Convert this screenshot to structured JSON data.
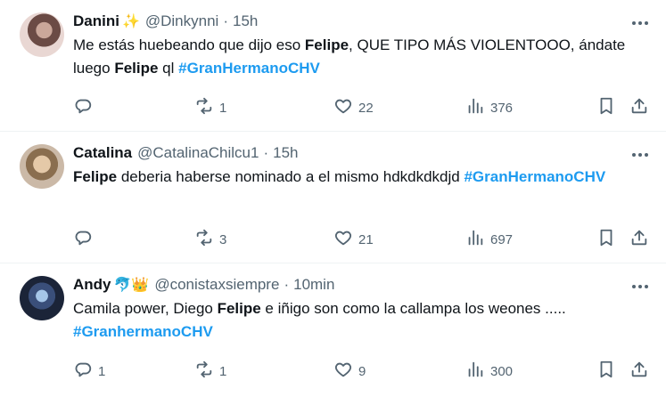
{
  "tweets": [
    {
      "name": "Danini",
      "emoji": "✨",
      "handle": "@Dinkynni",
      "dot": "·",
      "time": "15h",
      "text": [
        {
          "t": "Me estás huebeando que dijo eso ",
          "s": "n"
        },
        {
          "t": "Felipe",
          "s": "b"
        },
        {
          "t": ", QUE TIPO MÁS VIOLENTOOO, ándate luego ",
          "s": "n"
        },
        {
          "t": "Felipe",
          "s": "b"
        },
        {
          "t": " ql ",
          "s": "n"
        },
        {
          "t": "#GranHermanoCHV",
          "s": "h"
        }
      ],
      "replies": "",
      "retweets": "1",
      "likes": "22",
      "views": "376"
    },
    {
      "name": "Catalina",
      "emoji": "",
      "handle": "@CatalinaChilcu1",
      "dot": "·",
      "time": "15h",
      "text": [
        {
          "t": "Felipe",
          "s": "b"
        },
        {
          "t": " deberia haberse nominado a el mismo hdkdkdkdjd ",
          "s": "n"
        },
        {
          "t": "#GranHermanoCHV",
          "s": "h"
        }
      ],
      "replies": "",
      "retweets": "3",
      "likes": "21",
      "views": "697"
    },
    {
      "name": "Andy",
      "emoji": "🐬👑",
      "handle": "@conistaxsiempre",
      "dot": "·",
      "time": "10min",
      "text": [
        {
          "t": "Camila power, Diego ",
          "s": "n"
        },
        {
          "t": "Felipe",
          "s": "b"
        },
        {
          "t": " e iñigo son como la callampa los weones ..... ",
          "s": "n"
        },
        {
          "t": "#GranhermanoCHV",
          "s": "h"
        }
      ],
      "replies": "1",
      "retweets": "1",
      "likes": "9",
      "views": "300"
    }
  ],
  "icons": {
    "reply": "reply-icon",
    "retweet": "retweet-icon",
    "like": "heart-icon",
    "views": "views-icon",
    "bookmark": "bookmark-icon",
    "share": "share-icon",
    "more": "more-dots-icon"
  },
  "colors": {
    "hashtag": "#1d9bf0",
    "muted": "#536471",
    "text": "#0f1419"
  }
}
